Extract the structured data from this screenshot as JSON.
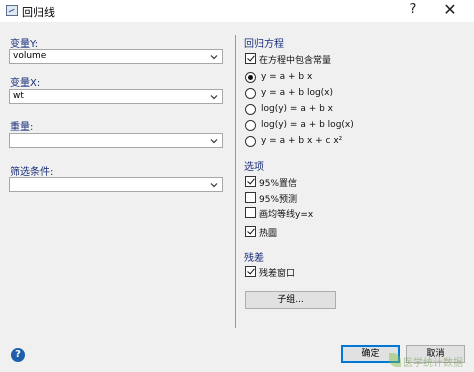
{
  "window": {
    "title": "回归线",
    "help_glyph": "?",
    "close_glyph": "✕"
  },
  "left": {
    "y_label": "变量Y:",
    "y_value": "volume",
    "x_label": "变量X:",
    "x_value": "wt",
    "weight_label": "重量:",
    "weight_value": "",
    "filter_label": "筛选条件:",
    "filter_value": ""
  },
  "equation": {
    "title": "回归方程",
    "include_constant_label": "在方程中包含常量",
    "include_constant_checked": true,
    "options": [
      {
        "label": "y = a + b x",
        "selected": true
      },
      {
        "label": "y = a + b log(x)",
        "selected": false
      },
      {
        "label": "log(y) = a + b x",
        "selected": false
      },
      {
        "label": "log(y) = a + b log(x)",
        "selected": false
      },
      {
        "label": "y = a + b x + c x²",
        "selected": false
      }
    ]
  },
  "options": {
    "title": "选项",
    "items": [
      {
        "label": "95%置信",
        "checked": true
      },
      {
        "label": "95%预测",
        "checked": false
      },
      {
        "label": "画均等线y=x",
        "checked": false
      },
      {
        "label": "热圖",
        "checked": true
      }
    ]
  },
  "residuals": {
    "title": "残差",
    "window_label": "残差窗口",
    "window_checked": true
  },
  "subgroups_button": "子组...",
  "footer": {
    "ok": "确定",
    "cancel": "取消",
    "help": "?"
  },
  "watermark": "医学统计数据",
  "colors": {
    "section_label": "#1a2f7a",
    "default_button_border": "#0078d7",
    "help_icon": "#1e5eaa"
  }
}
